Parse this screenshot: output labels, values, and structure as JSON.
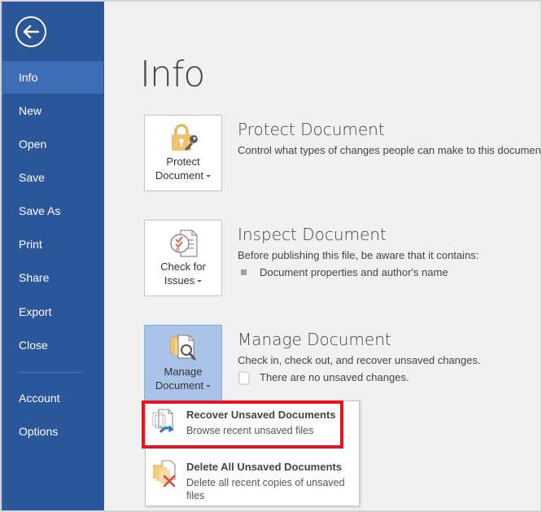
{
  "sidebar": {
    "back_icon": "back-arrow-circle-icon",
    "items": [
      {
        "label": "Info",
        "active": true
      },
      {
        "label": "New"
      },
      {
        "label": "Open"
      },
      {
        "label": "Save"
      },
      {
        "label": "Save As"
      },
      {
        "label": "Print"
      },
      {
        "label": "Share"
      },
      {
        "label": "Export"
      },
      {
        "label": "Close"
      },
      {
        "label": "Account"
      },
      {
        "label": "Options"
      }
    ]
  },
  "main": {
    "title": "Info",
    "protect": {
      "button_line1": "Protect",
      "button_line2": "Document",
      "icon": "lock-key-icon",
      "title": "Protect Document",
      "description": "Control what types of changes people can make to this document."
    },
    "inspect": {
      "button_line1": "Check for",
      "button_line2": "Issues",
      "icon": "check-issues-icon",
      "title": "Inspect Document",
      "description": "Before publishing this file, be aware that it contains:",
      "bullets": [
        "Document properties and author's name"
      ]
    },
    "manage": {
      "button_line1": "Manage",
      "button_line2": "Document",
      "icon": "manage-document-icon",
      "title": "Manage Document",
      "description": "Check in, check out, and recover unsaved changes.",
      "status": "There are no unsaved changes."
    },
    "dropdown": {
      "items": [
        {
          "title": "Recover Unsaved Documents",
          "subtitle": "Browse recent unsaved files",
          "icon": "recover-document-icon",
          "highlighted": true
        },
        {
          "title": "Delete All Unsaved Documents",
          "subtitle": "Delete all recent copies of unsaved files",
          "icon": "delete-documents-icon"
        }
      ]
    }
  },
  "colors": {
    "sidebar": "#2b579a",
    "sidebar_active": "#3e6db5",
    "highlight": "#e8141c",
    "tile_active": "#a9c3e8"
  }
}
